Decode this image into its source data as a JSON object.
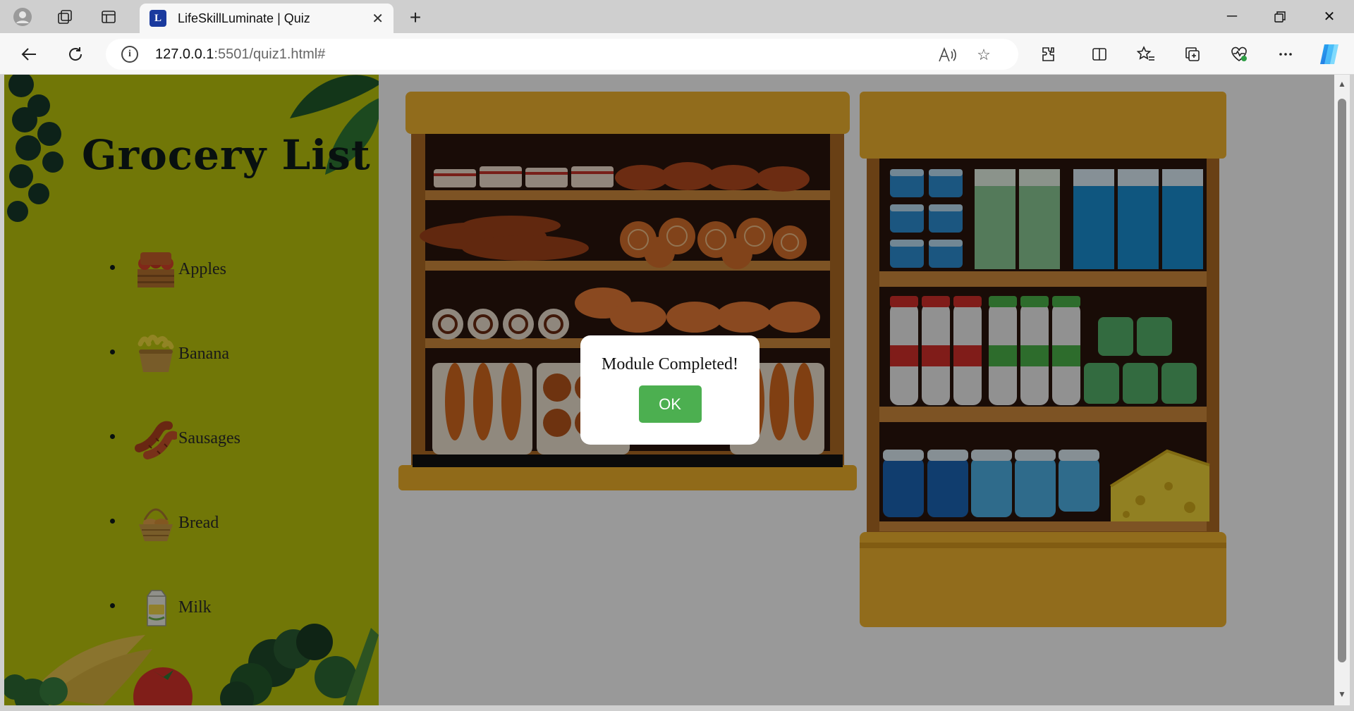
{
  "browser": {
    "tab_title": "LifeSkillLuminate | Quiz",
    "tab_favicon_letter": "L",
    "url_host": "127.0.0.1",
    "url_rest": ":5501/quiz1.html#",
    "icons": {
      "profile": "profile-icon",
      "workspaces": "workspaces-icon",
      "tab_actions": "vertical-tabs-icon",
      "new_tab": "plus-icon",
      "minimize": "minimize-icon",
      "restore": "restore-icon",
      "close": "close-icon",
      "back": "back-arrow-icon",
      "refresh": "refresh-icon",
      "site_info": "info-icon",
      "read_aloud": "read-aloud-icon",
      "favorite": "star-icon",
      "extensions": "puzzle-icon",
      "split": "split-screen-icon",
      "favorites": "favorites-icon",
      "collections": "collections-icon",
      "performance": "heart-pulse-icon",
      "more": "more-icon",
      "copilot": "copilot-icon"
    }
  },
  "sidebar": {
    "title": "Grocery List",
    "items": [
      {
        "label": "Apples",
        "icon": "apple-crate-icon"
      },
      {
        "label": "Banana",
        "icon": "banana-basket-icon"
      },
      {
        "label": "Sausages",
        "icon": "sausages-icon"
      },
      {
        "label": "Bread",
        "icon": "bread-basket-icon"
      },
      {
        "label": "Milk",
        "icon": "milk-carton-icon"
      }
    ]
  },
  "modal": {
    "message": "Module Completed!",
    "ok_label": "OK"
  },
  "colors": {
    "sidebar_bg": "#bcc70c",
    "ok_button": "#4caf50",
    "shelf_wood": "#c87a2a",
    "shelf_trim": "#f0b12a"
  }
}
